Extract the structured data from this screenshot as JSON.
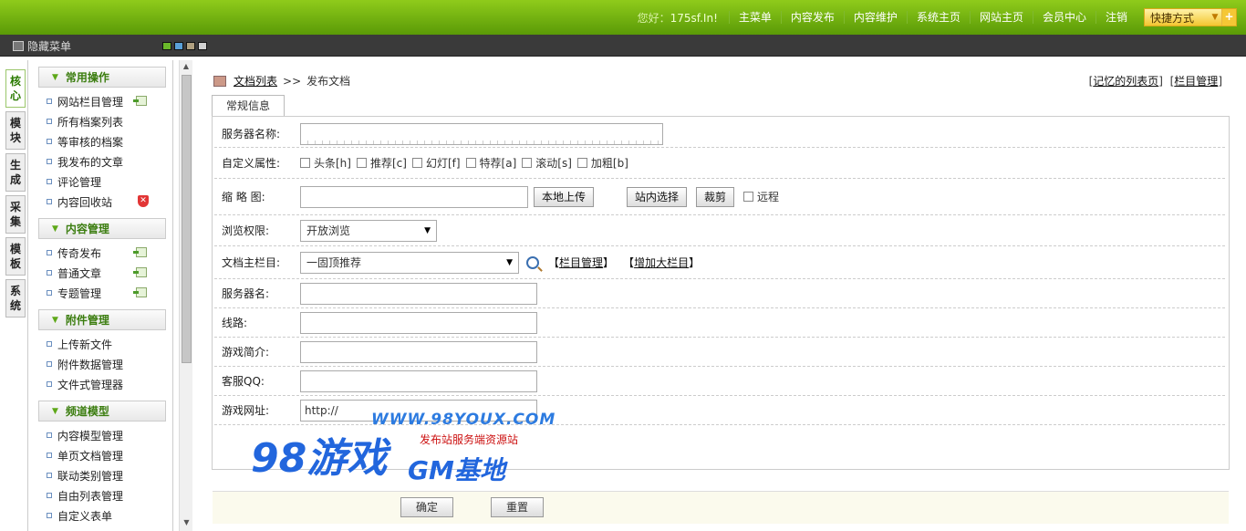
{
  "topbar": {
    "greeting_prefix": "您好：",
    "username": "175sf.In!",
    "nav": [
      "主菜单",
      "内容发布",
      "内容维护",
      "系统主页",
      "网站主页",
      "会员中心",
      "注销"
    ],
    "quick_label": "快捷方式",
    "quick_plus": "+"
  },
  "subbar": {
    "hide_menu": "隐藏菜单",
    "swatch_colors": [
      "#6ab82a",
      "#5aa0d8",
      "#b0a080",
      "#d0d0d0"
    ]
  },
  "vtabs": [
    "核心",
    "模块",
    "生成",
    "采集",
    "模板",
    "系统"
  ],
  "sidebar": {
    "groups": [
      {
        "title": "常用操作",
        "items": [
          "网站栏目管理",
          "所有档案列表",
          "等审核的档案",
          "我发布的文章",
          "评论管理",
          "内容回收站"
        ]
      },
      {
        "title": "内容管理",
        "items": [
          "传奇发布",
          "普通文章",
          "专题管理"
        ]
      },
      {
        "title": "附件管理",
        "items": [
          "上传新文件",
          "附件数据管理",
          "文件式管理器"
        ]
      },
      {
        "title": "频道模型",
        "items": [
          "内容模型管理",
          "单页文档管理",
          "联动类别管理",
          "自由列表管理",
          "自定义表单"
        ]
      }
    ]
  },
  "breadcrumb": {
    "link": "文档列表",
    "sep": ">>",
    "current": "发布文档"
  },
  "toplinks": {
    "remember": "记忆的列表页",
    "column_manage": "栏目管理"
  },
  "tab": "常规信息",
  "form": {
    "server_name_label": "服务器名称:",
    "custom_attr_label": "自定义属性:",
    "attrs": [
      "头条[h]",
      "推荐[c]",
      "幻灯[f]",
      "特荐[a]",
      "滚动[s]",
      "加粗[b]"
    ],
    "thumb_label": "缩 略 图:",
    "upload_btn": "本地上传",
    "site_select_btn": "站内选择",
    "crop_btn": "裁剪",
    "remote_label": "远程",
    "browse_label": "浏览权限:",
    "browse_value": "开放浏览",
    "main_col_label": "文档主栏目:",
    "main_col_value": "一固顶推荐",
    "col_manage_link": "栏目管理",
    "add_col_link": "增加大栏目",
    "server_label": "服务器名:",
    "line_label": "线路:",
    "intro_label": "游戏简介:",
    "qq_label": "客服QQ:",
    "url_label": "游戏网址:",
    "url_value": "http://",
    "confirm_btn": "确定",
    "reset_btn": "重置"
  },
  "watermark": {
    "url": "WWW.98YOUX.COM",
    "red_text": "发布站服务端资源站",
    "big": "98游戏",
    "gm": "GM基地"
  }
}
